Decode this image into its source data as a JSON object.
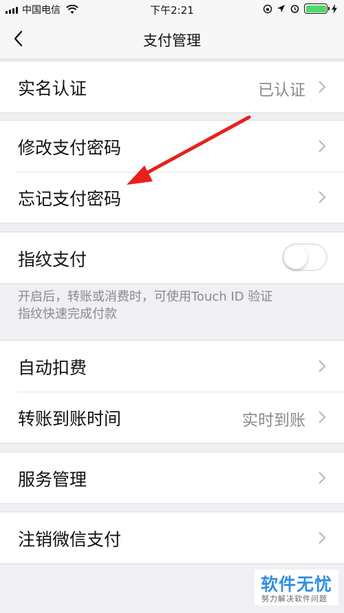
{
  "status_bar": {
    "carrier": "中国电信",
    "time": "下午2:21"
  },
  "nav": {
    "title": "支付管理"
  },
  "rows": {
    "real_name": {
      "label": "实名认证",
      "value": "已认证"
    },
    "change_password": {
      "label": "修改支付密码"
    },
    "forgot_password": {
      "label": "忘记支付密码"
    },
    "fingerprint": {
      "label": "指纹支付",
      "enabled": false
    },
    "auto_deduct": {
      "label": "自动扣费"
    },
    "transfer_time": {
      "label": "转账到账时间",
      "value": "实时到账"
    },
    "service_manage": {
      "label": "服务管理"
    },
    "cancel_wechat_pay": {
      "label": "注销微信支付"
    }
  },
  "fingerprint_note": {
    "line1": "开启后，转账或消费时，可使用Touch ID 验证",
    "line2": "指纹快速完成付款"
  },
  "watermark": {
    "title": "软件无忧",
    "subtitle": "努力解决软件问题"
  },
  "colors": {
    "background": "#efeff4",
    "arrow": "#e8201c",
    "battery": "#4cd964",
    "watermark": "#2e8fe6"
  }
}
